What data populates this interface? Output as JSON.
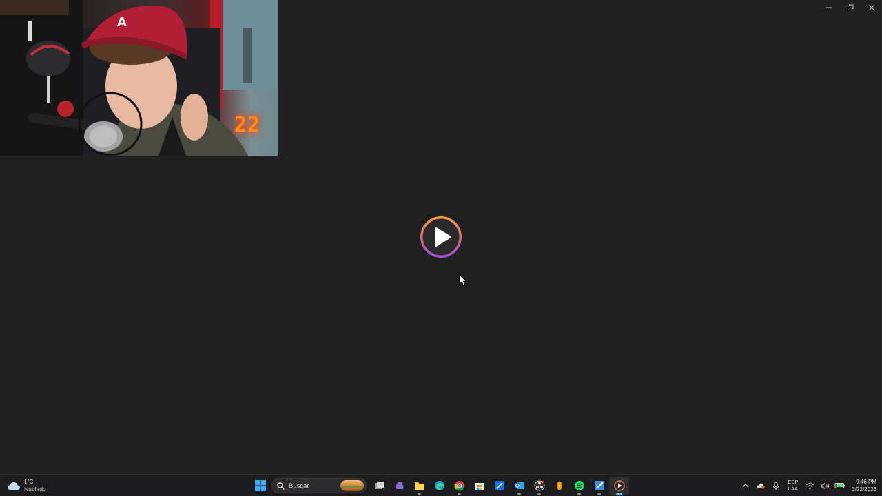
{
  "webcam": {
    "neon_digits": "22"
  },
  "player": {
    "play_button_icon": "play-icon",
    "colors": {
      "ring_start": "#f59a3c",
      "ring_end": "#a54bd8",
      "glyph": "#ffffff"
    }
  },
  "window_controls": [
    "minimize-icon",
    "restore-icon",
    "close-icon"
  ],
  "taskbar": {
    "weather": {
      "temperature": "1°C",
      "condition": "Nublado",
      "icon": "cloud-icon"
    },
    "search": {
      "placeholder": "Buscar"
    },
    "apps": [
      {
        "icon": "windows-start-icon"
      },
      {
        "icon": "search-icon"
      },
      {
        "icon": "task-view-icon"
      },
      {
        "icon": "copilot-icon"
      },
      {
        "icon": "file-explorer-icon"
      },
      {
        "icon": "edge-icon"
      },
      {
        "icon": "chrome-icon"
      },
      {
        "icon": "store-icon"
      },
      {
        "icon": "editor-icon"
      },
      {
        "icon": "outlook-icon"
      },
      {
        "icon": "obs-icon"
      },
      {
        "icon": "fl-studio-icon"
      },
      {
        "icon": "spotify-icon"
      },
      {
        "icon": "paint-icon"
      },
      {
        "icon": "media-player-icon"
      }
    ],
    "tray": {
      "language_primary": "ESP",
      "language_secondary": "LAA",
      "time": "9:46 PM",
      "date": "3/22/2026"
    }
  }
}
